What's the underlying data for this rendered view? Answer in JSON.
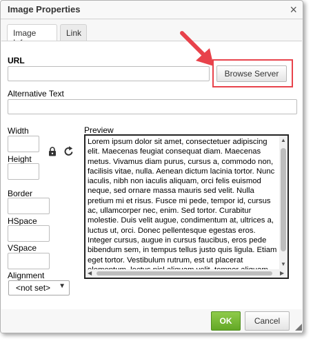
{
  "dialog": {
    "title": "Image Properties",
    "close_icon": "×"
  },
  "tabs": [
    {
      "label": "Image Info"
    },
    {
      "label": "Link"
    }
  ],
  "fields": {
    "url_label": "URL",
    "browse_label": "Browse Server",
    "alt_label": "Alternative Text",
    "width_label": "Width",
    "height_label": "Height",
    "border_label": "Border",
    "hspace_label": "HSpace",
    "vspace_label": "VSpace",
    "alignment_label": "Alignment",
    "alignment_value": "<not set>",
    "url_value": "",
    "alt_value": "",
    "width_value": "",
    "height_value": "",
    "border_value": "",
    "hspace_value": "",
    "vspace_value": ""
  },
  "preview": {
    "label": "Preview",
    "text": "Lorem ipsum dolor sit amet, consectetuer adipiscing elit. Maecenas feugiat consequat diam. Maecenas metus. Vivamus diam purus, cursus a, commodo non, facilisis vitae, nulla. Aenean dictum lacinia tortor. Nunc iaculis, nibh non iaculis aliquam, orci felis euismod neque, sed ornare massa mauris sed velit. Nulla pretium mi et risus. Fusce mi pede, tempor id, cursus ac, ullamcorper nec, enim. Sed tortor. Curabitur molestie. Duis velit augue, condimentum at, ultrices a, luctus ut, orci. Donec pellentesque egestas eros. Integer cursus, augue in cursus faucibus, eros pede bibendum sem, in tempus tellus justo quis ligula. Etiam eget tortor. Vestibulum rutrum, est ut placerat elementum, lectus nisl aliquam velit, tempor aliquam eros nunc nonummy metus."
  },
  "footer": {
    "ok_label": "OK",
    "cancel_label": "Cancel"
  },
  "colors": {
    "ok_green": "#6cb52d",
    "highlight_red": "#e8424b",
    "annotation_arrow_red": "#e8424b"
  },
  "icons": {
    "lock": "lock-icon",
    "reset": "reset-size-icon",
    "close": "close-icon",
    "resize_grip": "resize-grip-icon"
  }
}
